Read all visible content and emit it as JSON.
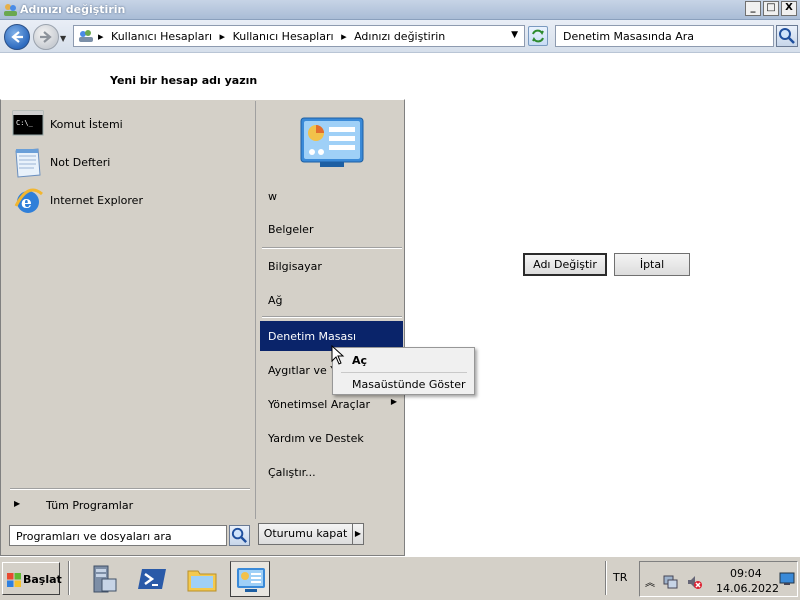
{
  "window": {
    "title": "Adınızı değiştirin",
    "controls": {
      "minimize": "_",
      "maximize": "□",
      "close": "X"
    }
  },
  "address_bar": {
    "breadcrumbs": [
      "Kullanıcı Hesapları",
      "Kullanıcı Hesapları",
      "Adınızı değiştirin"
    ],
    "search_placeholder": "Denetim Masasında Ara"
  },
  "content": {
    "heading": "Yeni bir hesap adı yazın",
    "rename_button": "Adı Değiştir",
    "cancel_button": "İptal"
  },
  "start_menu": {
    "pinned": [
      {
        "label": "Komut İstemi",
        "icon": "cmd-icon"
      },
      {
        "label": "Not Defteri",
        "icon": "notepad-icon"
      },
      {
        "label": "Internet Explorer",
        "icon": "internet-explorer-icon"
      }
    ],
    "all_programs": "Tüm Programlar",
    "search_placeholder": "Programları ve dosyaları ara",
    "right_items": {
      "user": "w",
      "documents": "Belgeler",
      "computer": "Bilgisayar",
      "network": "Ağ",
      "control_panel": "Denetim Masası",
      "devices": "Aygıtlar ve Ya",
      "admin_tools": "Yönetimsel Araçlar",
      "help": "Yardım ve Destek",
      "run": "Çalıştır..."
    },
    "shutdown": "Oturumu kapat"
  },
  "context_menu": {
    "open": "Aç",
    "show_on_desktop": "Masaüstünde Göster"
  },
  "taskbar": {
    "start": "Başlat",
    "language": "TR",
    "time": "09:04",
    "date": "14.06.2022"
  },
  "colors": {
    "selection": "#0a246a",
    "menu_bg": "#d4d0c8",
    "titlebar": "#a9bcd6"
  }
}
